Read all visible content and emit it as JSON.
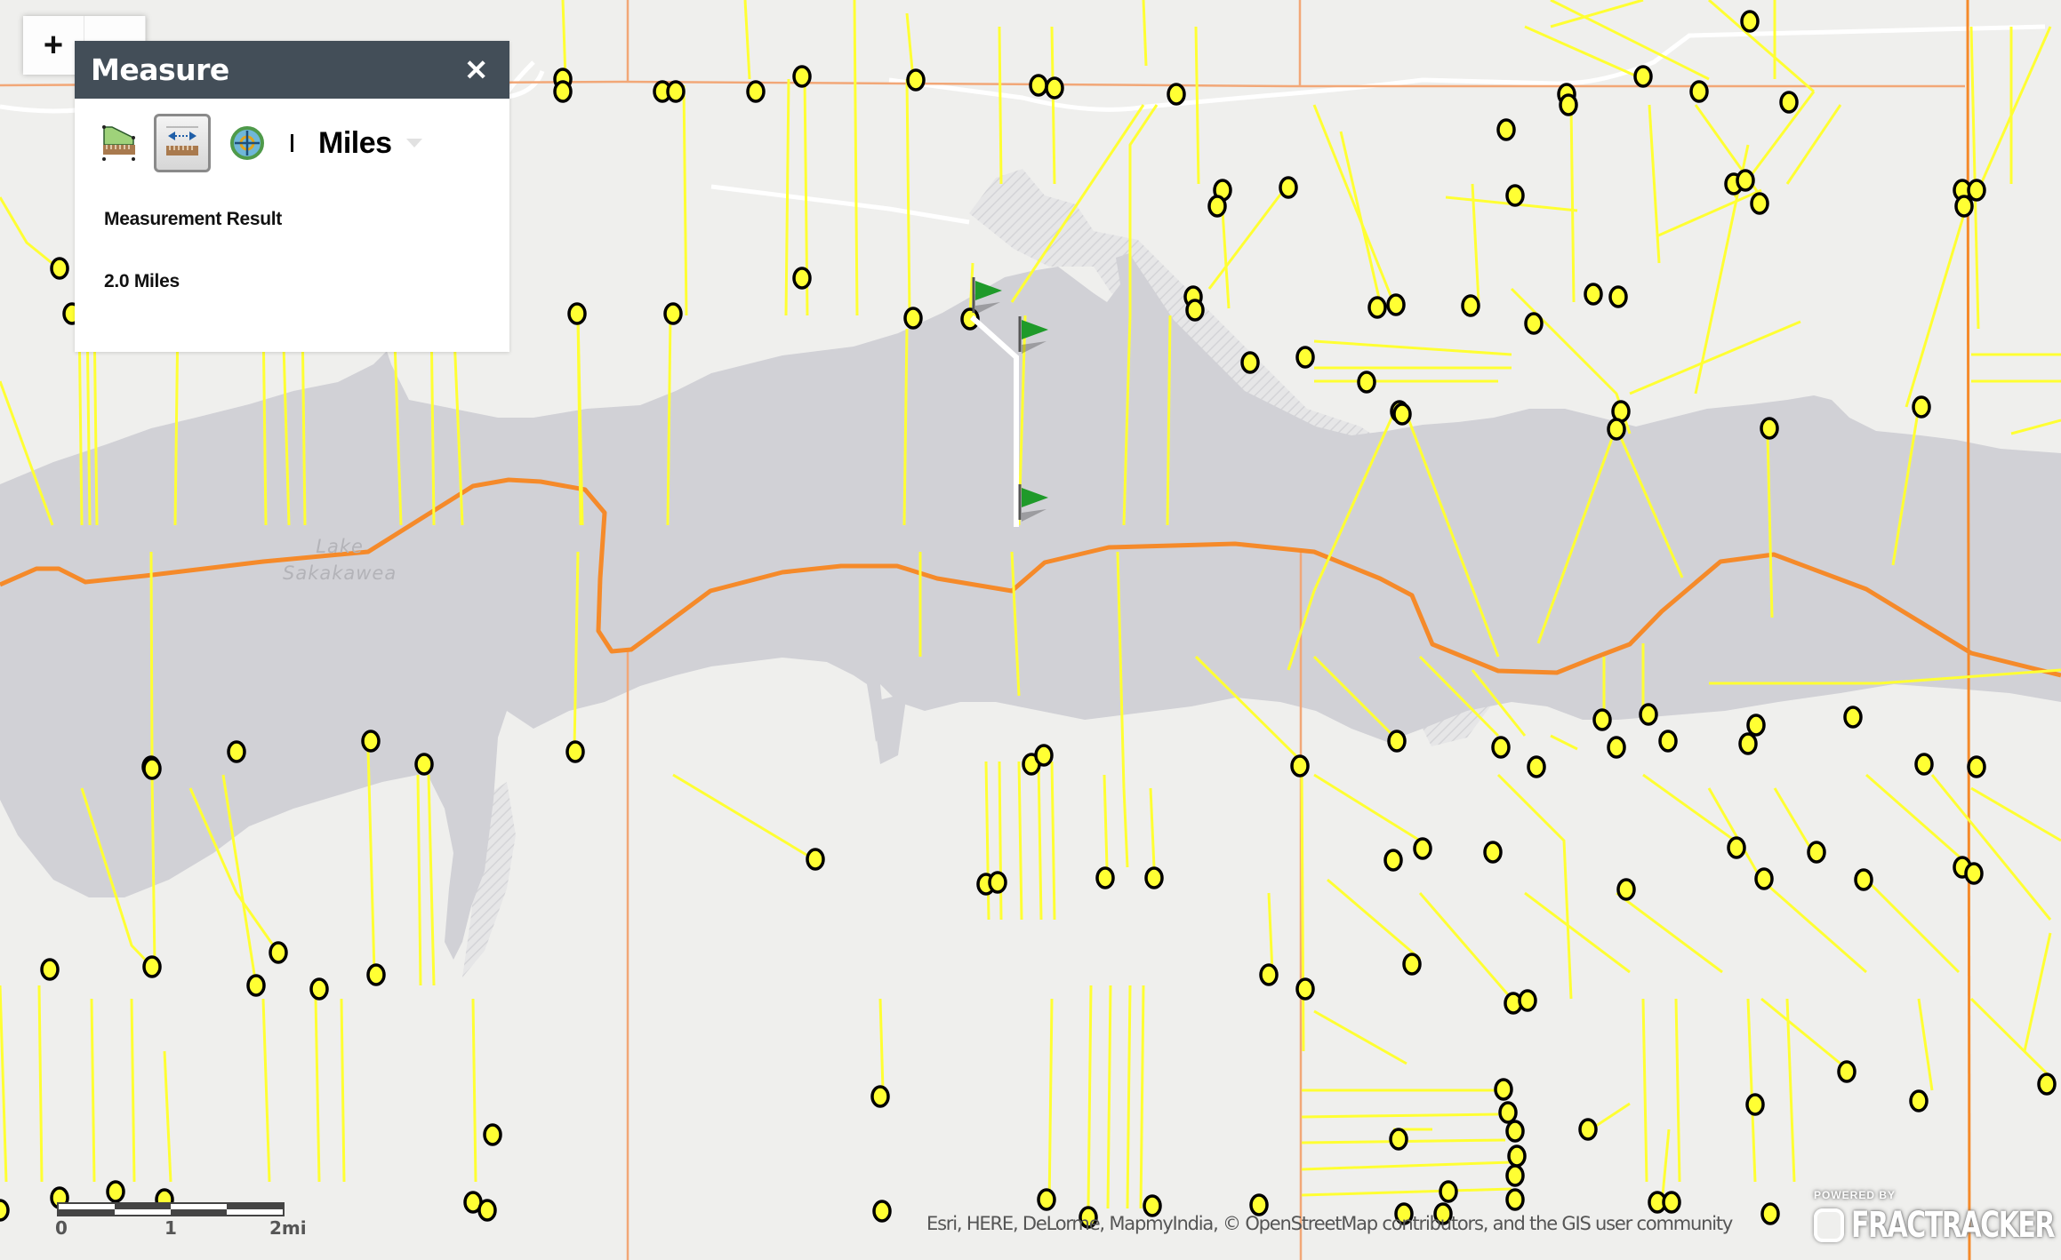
{
  "map": {
    "zoom_in_label": "+",
    "lake_label_line1": "Lake",
    "lake_label_line2": "Sakakawea",
    "colors": {
      "land": "#efefed",
      "water": "#d1d1d6",
      "boundary": "#f58a2a",
      "well_line": "#ffff33",
      "well_point_fill": "#ffff33",
      "well_point_stroke": "#000000",
      "measure_line": "#ffffff",
      "flag": "#1f9a2a"
    }
  },
  "measure_panel": {
    "title": "Measure",
    "close_label": "✕",
    "tools": [
      {
        "name": "area-tool",
        "icon": "area-ruler-icon",
        "active": false
      },
      {
        "name": "distance-tool",
        "icon": "distance-ruler-icon",
        "active": true
      },
      {
        "name": "location-tool",
        "icon": "location-globe-icon",
        "active": false
      }
    ],
    "unit_selected": "Miles",
    "result_label": "Measurement Result",
    "result_value": "2.0 Miles"
  },
  "scalebar": {
    "labels": [
      "0",
      "1",
      "2mi"
    ]
  },
  "attribution": "Esri, HERE, DeLorme, MapmyIndia, © OpenStreetMap contributors, and the GIS user community",
  "branding": {
    "powered_by": "POWERED BY",
    "name": "FRACTRACKER"
  }
}
